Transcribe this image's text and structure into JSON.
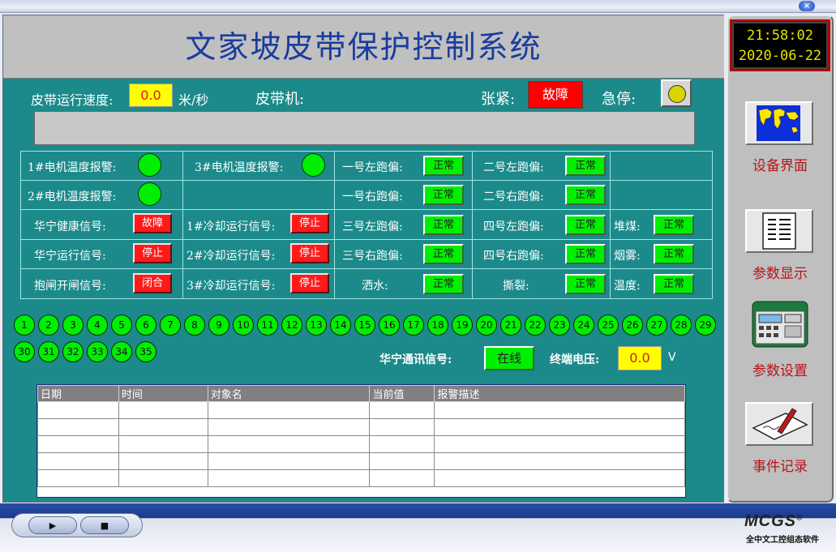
{
  "window": {
    "close_glyph": "×"
  },
  "title": "文家坡皮带保护控制系统",
  "status_row": {
    "belt_speed_label": "皮带运行速度:",
    "belt_speed_value": "0.0",
    "belt_speed_unit": "米/秒",
    "belt_machine_label": "皮带机:",
    "tension_label": "张紧:",
    "tension_value": "故障",
    "estop_label": "急停:"
  },
  "grid": {
    "motor1_temp": "1#电机温度报警:",
    "motor2_temp": "2#电机温度报警:",
    "motor3_temp": "3#电机温度报警:",
    "huaning_health": "华宁健康信号:",
    "huaning_health_value": "故障",
    "huaning_run": "华宁运行信号:",
    "huaning_run_value": "停止",
    "brake_switch": "抱闸开闸信号:",
    "brake_switch_value": "闭合",
    "cool1": "1#冷却运行信号:",
    "cool1_value": "停止",
    "cool2": "2#冷却运行信号:",
    "cool2_value": "停止",
    "cool3": "3#冷却运行信号:",
    "cool3_value": "停止",
    "dev_1l": "一号左跑偏:",
    "dev_1l_value": "正常",
    "dev_1r": "一号右跑偏:",
    "dev_1r_value": "正常",
    "dev_3l": "三号左跑偏:",
    "dev_3l_value": "正常",
    "dev_3r": "三号右跑偏:",
    "dev_3r_value": "正常",
    "spray": "洒水:",
    "spray_value": "正常",
    "dev_2l": "二号左跑偏:",
    "dev_2l_value": "正常",
    "dev_2r": "二号右跑偏:",
    "dev_2r_value": "正常",
    "dev_4l": "四号左跑偏:",
    "dev_4l_value": "正常",
    "dev_4r": "四号右跑偏:",
    "dev_4r_value": "正常",
    "tear": "撕裂:",
    "tear_value": "正常",
    "coal_pile": "堆煤:",
    "coal_pile_value": "正常",
    "smoke": "烟雾:",
    "smoke_value": "正常",
    "temp": "温度:",
    "temp_value": "正常"
  },
  "nodes_row1": [
    "1",
    "2",
    "3",
    "4",
    "5",
    "6",
    "7",
    "8",
    "9",
    "10",
    "11",
    "12",
    "13",
    "14",
    "15",
    "16",
    "17",
    "18",
    "19",
    "20",
    "21",
    "22",
    "23",
    "24",
    "25",
    "26",
    "27",
    "28",
    "29"
  ],
  "nodes_row2": [
    "30",
    "31",
    "32",
    "33",
    "34",
    "35"
  ],
  "comm": {
    "label": "华宁通讯信号:",
    "value": "在线",
    "voltage_label": "终端电压:",
    "voltage_value": "0.0",
    "voltage_unit": "V"
  },
  "alarm_table": {
    "columns": [
      "日期",
      "时间",
      "对象名",
      "当前值",
      "报警描述"
    ],
    "rows": [
      [
        "",
        "",
        "",
        "",
        ""
      ],
      [
        "",
        "",
        "",
        "",
        ""
      ],
      [
        "",
        "",
        "",
        "",
        ""
      ],
      [
        "",
        "",
        "",
        "",
        ""
      ],
      [
        "",
        "",
        "",
        "",
        ""
      ]
    ]
  },
  "clock": {
    "time": "21:58:02",
    "date": "2020-06-22"
  },
  "sidebar": {
    "items": [
      {
        "label": "设备界面",
        "icon": "world-map-icon"
      },
      {
        "label": "参数显示",
        "icon": "document-icon"
      },
      {
        "label": "参数设置",
        "icon": "control-panel-icon"
      },
      {
        "label": "事件记录",
        "icon": "pen-paper-icon"
      }
    ]
  },
  "player": {
    "play_glyph": "▶",
    "stop_glyph": "■"
  },
  "brand": {
    "name": "MCGS",
    "reg": "®",
    "subtitle": "全中文工控组态软件"
  },
  "colors": {
    "panel": "#1c8a8a",
    "ok": "#00ee00",
    "fault": "#ff0000",
    "title": "#1a3c9e"
  }
}
